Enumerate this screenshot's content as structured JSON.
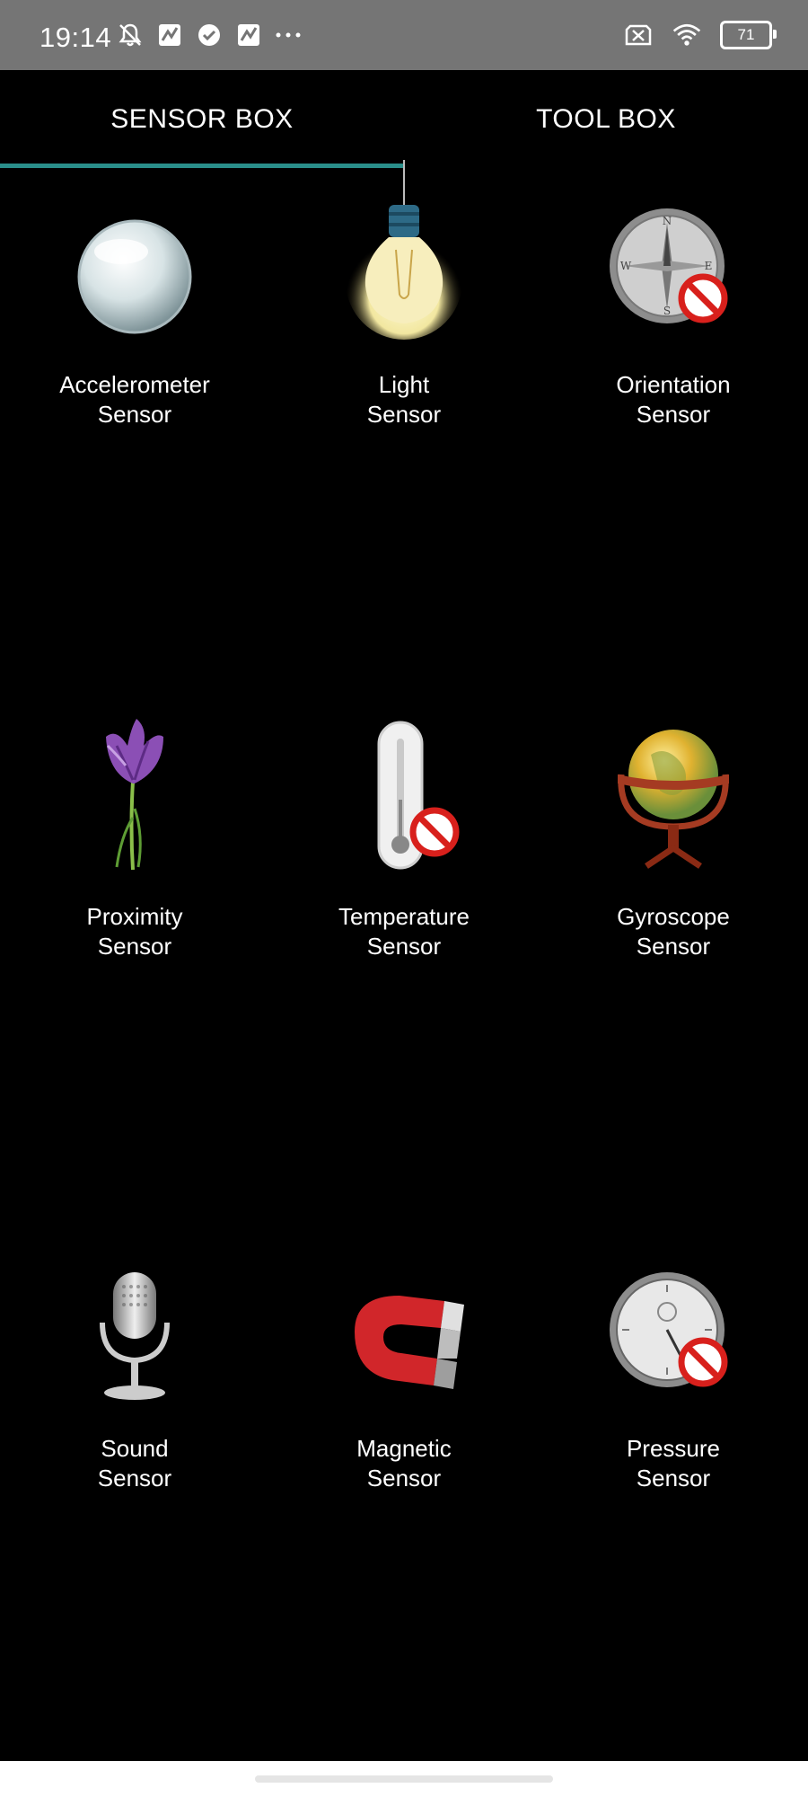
{
  "status_bar": {
    "time": "19:14",
    "battery": "71",
    "icons_left": [
      "bell-off-icon",
      "app-icon",
      "check-circle-icon",
      "app-icon",
      "more-dots-icon"
    ],
    "icons_right": [
      "no-sim-icon",
      "wifi-icon",
      "battery-icon"
    ]
  },
  "tabs": [
    {
      "label": "SENSOR BOX",
      "selected": true
    },
    {
      "label": "TOOL BOX",
      "selected": false
    }
  ],
  "accent_color": "#2a8e8a",
  "sensors": [
    {
      "line1": "Accelerometer",
      "line2": "Sensor",
      "icon": "glass-ball-icon",
      "unavailable": false
    },
    {
      "line1": "Light",
      "line2": "Sensor",
      "icon": "light-bulb-icon",
      "unavailable": false
    },
    {
      "line1": "Orientation",
      "line2": "Sensor",
      "icon": "compass-icon",
      "unavailable": true
    },
    {
      "line1": "Proximity",
      "line2": "Sensor",
      "icon": "crocus-flower-icon",
      "unavailable": false
    },
    {
      "line1": "Temperature",
      "line2": "Sensor",
      "icon": "thermometer-icon",
      "unavailable": true
    },
    {
      "line1": "Gyroscope",
      "line2": "Sensor",
      "icon": "globe-icon",
      "unavailable": false
    },
    {
      "line1": "Sound",
      "line2": "Sensor",
      "icon": "microphone-icon",
      "unavailable": false
    },
    {
      "line1": "Magnetic",
      "line2": "Sensor",
      "icon": "magnet-icon",
      "unavailable": false
    },
    {
      "line1": "Pressure",
      "line2": "Sensor",
      "icon": "barometer-icon",
      "unavailable": true
    }
  ]
}
